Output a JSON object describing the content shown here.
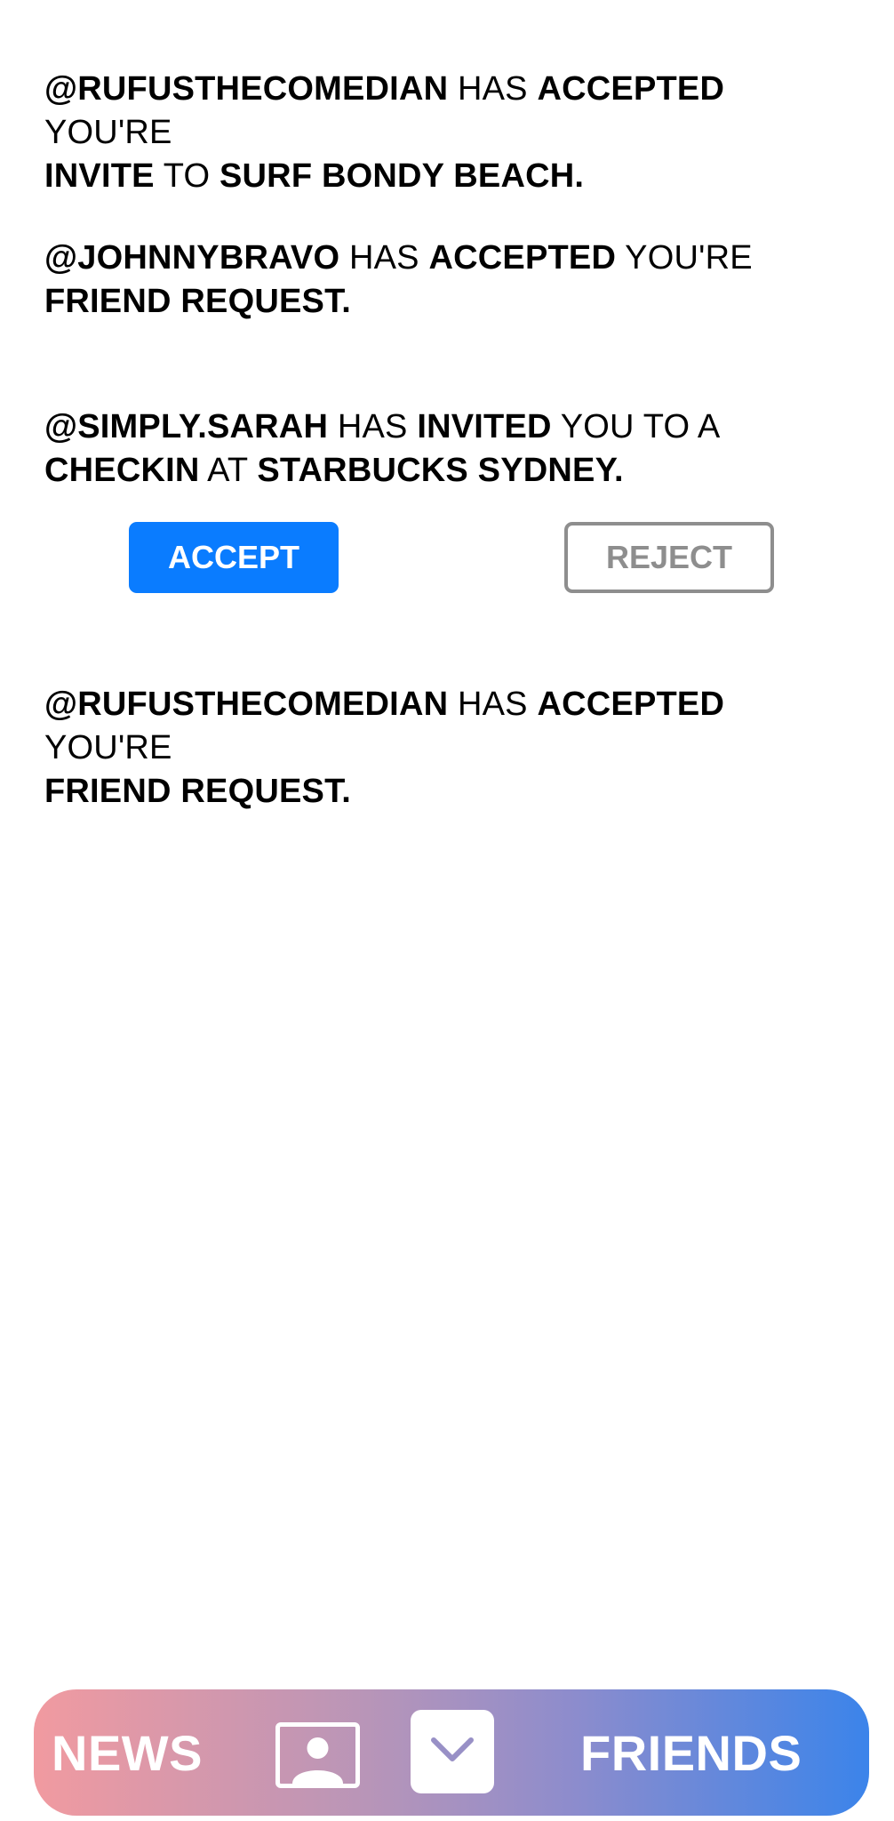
{
  "notifications": [
    {
      "line1": [
        {
          "text": "@RUFUSTHECOMEDIAN",
          "bold": true
        },
        {
          "text": " HAS ",
          "bold": false
        },
        {
          "text": "ACCEPTED",
          "bold": true
        },
        {
          "text": " YOU'RE",
          "bold": false
        }
      ],
      "line2": [
        {
          "text": "INVITE",
          "bold": true
        },
        {
          "text": " TO ",
          "bold": false
        },
        {
          "text": "SURF BONDY BEACH.",
          "bold": true
        }
      ]
    },
    {
      "line1": [
        {
          "text": "@JOHNNYBRAVO",
          "bold": true
        },
        {
          "text": " HAS ",
          "bold": false
        },
        {
          "text": "ACCEPTED",
          "bold": true
        },
        {
          "text": " YOU'RE",
          "bold": false
        }
      ],
      "line2": [
        {
          "text": "FRIEND REQUEST.",
          "bold": true
        }
      ]
    },
    {
      "line1": [
        {
          "text": "@SIMPLY.SARAH",
          "bold": true
        },
        {
          "text": " HAS ",
          "bold": false
        },
        {
          "text": "INVITED",
          "bold": true
        },
        {
          "text": " YOU TO A",
          "bold": false
        }
      ],
      "line2": [
        {
          "text": "CHECKIN",
          "bold": true
        },
        {
          "text": " AT ",
          "bold": false
        },
        {
          "text": "STARBUCKS SYDNEY.",
          "bold": true
        }
      ],
      "actions": {
        "accept_label": "ACCEPT",
        "reject_label": "REJECT"
      }
    },
    {
      "line1": [
        {
          "text": "@RUFUSTHECOMEDIAN",
          "bold": true
        },
        {
          "text": " HAS ",
          "bold": false
        },
        {
          "text": "ACCEPTED",
          "bold": true
        },
        {
          "text": " YOU'RE",
          "bold": false
        }
      ],
      "line2": [
        {
          "text": "FRIEND REQUEST.",
          "bold": true
        }
      ]
    }
  ],
  "tabbar": {
    "news_label": "NEWS",
    "friends_label": "FRIENDS",
    "profile_icon": "profile-icon",
    "checkin_icon": "chevron-down-icon",
    "gradient_start": "#f19aa0",
    "gradient_end": "#3b84ea"
  },
  "colors": {
    "accept": "#0a7cff",
    "reject_border": "#8e8e8e"
  }
}
